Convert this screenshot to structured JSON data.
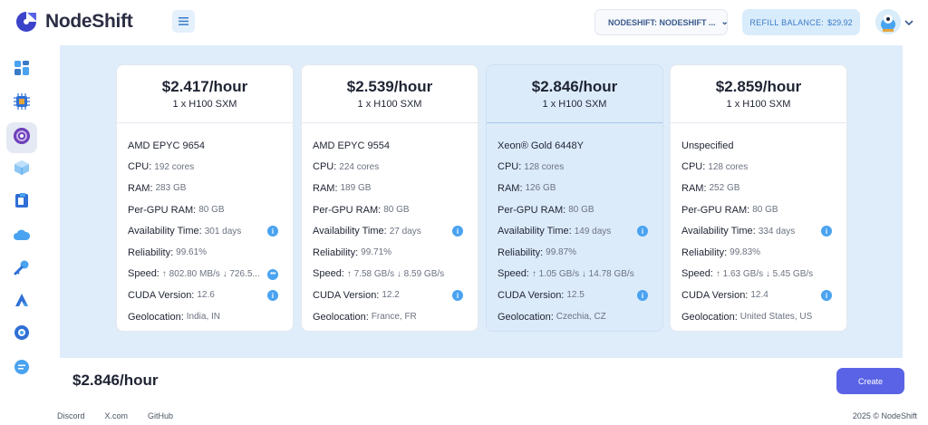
{
  "header": {
    "brand": "NodeShift",
    "org_select": "NODESHIFT: NODESHIFT ...",
    "refill_label": "REFILL BALANCE:",
    "refill_amount": "$29.92"
  },
  "sidebar": {
    "items": [
      {
        "name": "dashboard-icon",
        "active": false
      },
      {
        "name": "chip-icon",
        "active": false
      },
      {
        "name": "gpu-icon",
        "active": true
      },
      {
        "name": "cube-icon",
        "active": false
      },
      {
        "name": "storage-icon",
        "active": false
      },
      {
        "name": "cloud-icon",
        "active": false
      },
      {
        "name": "key-icon",
        "active": false
      },
      {
        "name": "deploy-icon",
        "active": false
      },
      {
        "name": "network-icon",
        "active": false
      },
      {
        "name": "chat-icon",
        "active": false
      }
    ]
  },
  "labels": {
    "cpu": "CPU:",
    "ram": "RAM:",
    "per_gpu_ram": "Per-GPU RAM:",
    "availability": "Availability Time:",
    "reliability": "Reliability:",
    "speed": "Speed:",
    "cuda": "CUDA Version:",
    "geo": "Geolocation:"
  },
  "cards": [
    {
      "price": "$2.417/hour",
      "gpu": "1 x H100 SXM",
      "cpu_name": "AMD EPYC 9654",
      "cpu": "192 cores",
      "ram": "283 GB",
      "per_gpu_ram": "80 GB",
      "availability": "301 days",
      "reliability": "99.61%",
      "speed": "↑ 802.80 MB/s ↓ 726.5...",
      "cuda": "12.6",
      "geo": "India, IN",
      "selected": false
    },
    {
      "price": "$2.539/hour",
      "gpu": "1 x H100 SXM",
      "cpu_name": "AMD EPYC 9554",
      "cpu": "224 cores",
      "ram": "189 GB",
      "per_gpu_ram": "80 GB",
      "availability": "27 days",
      "reliability": "99.71%",
      "speed": "↑ 7.58 GB/s ↓ 8.59 GB/s",
      "cuda": "12.2",
      "geo": "France, FR",
      "selected": false
    },
    {
      "price": "$2.846/hour",
      "gpu": "1 x H100 SXM",
      "cpu_name": "Xeon® Gold 6448Y",
      "cpu": "128 cores",
      "ram": "126 GB",
      "per_gpu_ram": "80 GB",
      "availability": "149 days",
      "reliability": "99.87%",
      "speed": "↑ 1.05 GB/s ↓ 14.78 GB/s",
      "cuda": "12.5",
      "geo": "Czechia, CZ",
      "selected": true
    },
    {
      "price": "$2.859/hour",
      "gpu": "1 x H100 SXM",
      "cpu_name": "Unspecified",
      "cpu": "128 cores",
      "ram": "252 GB",
      "per_gpu_ram": "80 GB",
      "availability": "334 days",
      "reliability": "99.83%",
      "speed": "↑ 1.63 GB/s ↓ 5.45 GB/s",
      "cuda": "12.4",
      "geo": "United States, US",
      "selected": false
    }
  ],
  "footer": {
    "total": "$2.846/hour",
    "create_label": "Create",
    "links": [
      "Discord",
      "X.com",
      "GitHub"
    ],
    "copyright": "2025 © NodeShift"
  },
  "colors": {
    "accent": "#5a63e6",
    "info": "#4aa3f0",
    "selected_bg": "#dcebfa",
    "content_bg": "#dfedfa"
  }
}
